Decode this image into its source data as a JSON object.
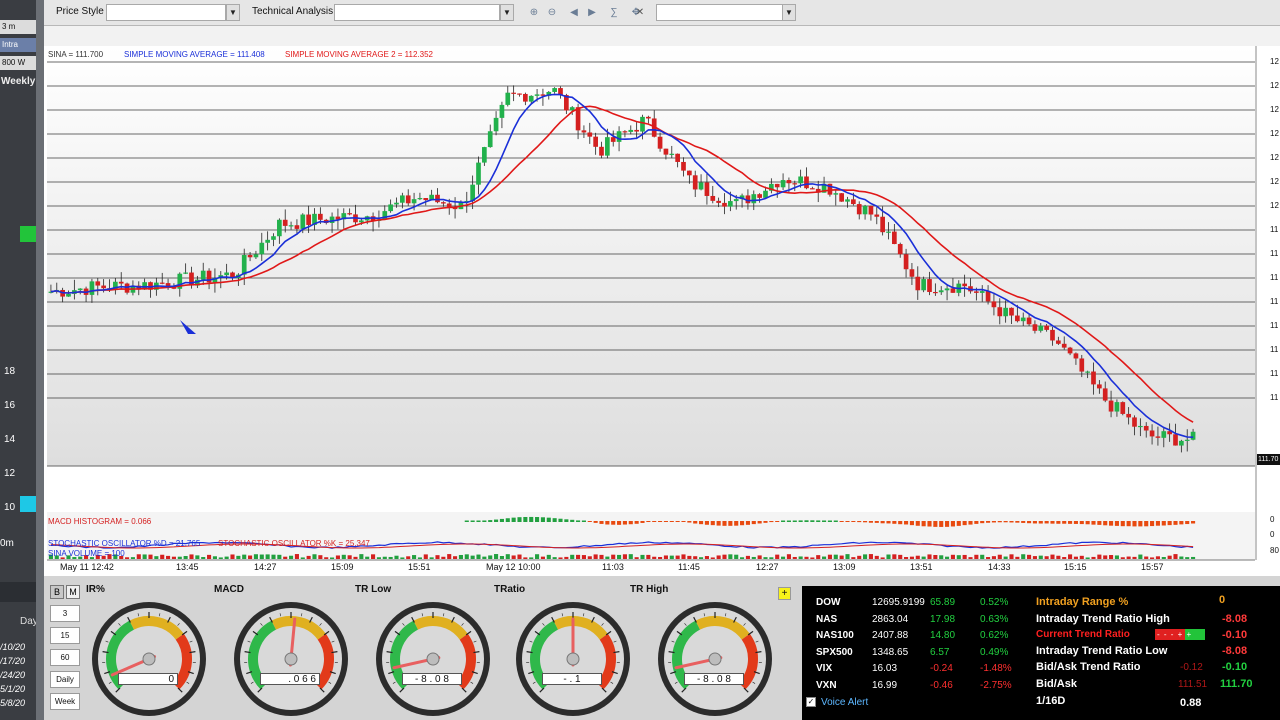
{
  "left_panel": {
    "tabs": [
      "3 m",
      "Intra",
      "800 W"
    ],
    "weekly_label": "Weekly",
    "price_ticks": [
      "18",
      "16",
      "14",
      "12",
      "10"
    ],
    "time_label": "0m",
    "day_label": "Day",
    "dates": [
      "/10/20",
      "/17/20",
      "/24/20",
      "5/1/20",
      "5/8/20"
    ]
  },
  "toolbar": {
    "price_style_label": "Price Style",
    "technical_analysis_label": "Technical Analysis"
  },
  "chart": {
    "legend": {
      "sina": "SINA = 111.700",
      "sma1": "SIMPLE MOVING AVERAGE = 111.408",
      "sma2": "SIMPLE MOVING AVERAGE 2 = 112.352"
    },
    "current_price_tag": "111.70",
    "indicators": {
      "macd": "MACD HISTOGRAM = 0.066",
      "stoch_k": "STOCHASTIC OSCILLATOR %D = 21.765",
      "stoch_d": "STOCHASTIC OSCILLATOR %K = 25.347",
      "volume": "SINA VOLUME = 100"
    },
    "right_ticks": [
      "12",
      "12",
      "12",
      "12",
      "12",
      "12",
      "12",
      "11",
      "11",
      "11",
      "11",
      "11",
      "11",
      "11",
      "11"
    ],
    "indicator_ticks": [
      "0",
      "0",
      "80"
    ],
    "x_labels": [
      "May 11 12:42",
      "13:45",
      "14:27",
      "15:09",
      "15:51",
      "May 12 10:00",
      "11:03",
      "11:45",
      "12:27",
      "13:09",
      "13:51",
      "14:33",
      "15:15",
      "15:57"
    ],
    "colors": {
      "up": "#22b14c",
      "down": "#d42020",
      "sma1": "#1a2fd8",
      "sma2": "#e01818"
    }
  },
  "chart_data": {
    "type": "candlestick",
    "x_labels": [
      "May 11 12:42",
      "13:45",
      "14:27",
      "15:09",
      "15:51",
      "May 12 10:00",
      "11:03",
      "11:45",
      "12:27",
      "13:09",
      "13:51",
      "14:33",
      "15:15",
      "15:57"
    ],
    "series": [
      {
        "name": "SINA",
        "last": 111.7
      },
      {
        "name": "SIMPLE MOVING AVERAGE",
        "last": 111.408
      },
      {
        "name": "SIMPLE MOVING AVERAGE 2",
        "last": 112.352
      }
    ],
    "close_path": [
      107.05,
      107.3,
      107.4,
      107.7,
      108.0,
      110.8,
      111.1,
      111.3,
      112.3,
      111.8,
      117.9,
      118.3,
      114.9,
      116.6,
      113.1,
      111.9,
      113.4,
      112.9,
      111.3,
      107.4,
      107.4,
      105.6,
      104.3,
      101.2,
      99.0,
      98.8
    ]
  },
  "bottom": {
    "period_buttons": [
      "B",
      "M",
      "3",
      "15",
      "60",
      "Daily",
      "Week"
    ],
    "gauges": [
      {
        "title": "IR%",
        "value": "0",
        "needle": 0.08
      },
      {
        "title": "MACD",
        "value": ". 0 6 6",
        "needle": 0.52
      },
      {
        "title": "TR Low",
        "value": "- 8 . 0 8",
        "needle": 0.12
      },
      {
        "title": "TRatio",
        "value": "- .  1",
        "needle": 0.5
      },
      {
        "title": "TR High",
        "value": "- 8 . 0 8",
        "needle": 0.12
      }
    ],
    "yellow_button": "+"
  },
  "market": [
    {
      "sym": "DOW",
      "last": "12695.9199",
      "chg": "65.89",
      "pct": "0.52%",
      "up": true
    },
    {
      "sym": "NAS",
      "last": "2863.04",
      "chg": "17.98",
      "pct": "0.63%",
      "up": true
    },
    {
      "sym": "NAS100",
      "last": "2407.88",
      "chg": "14.80",
      "pct": "0.62%",
      "up": true
    },
    {
      "sym": "SPX500",
      "last": "1348.65",
      "chg": "6.57",
      "pct": "0.49%",
      "up": true
    },
    {
      "sym": "VIX",
      "last": "16.03",
      "chg": "-0.24",
      "pct": "-1.48%",
      "up": false
    },
    {
      "sym": "VXN",
      "last": "16.99",
      "chg": "-0.46",
      "pct": "-2.75%",
      "up": false
    }
  ],
  "voice_alert": "Voice Alert",
  "trend": {
    "range_label": "Intraday Range %",
    "range_value": "0",
    "high_label": "Intraday Trend Ratio High",
    "high_value": "-8.08",
    "current_label": "Current Trend Ratio",
    "current_value": "-0.10",
    "current_bar": "- - - + +",
    "low_label": "Intraday Trend Ratio Low",
    "low_value": "-8.08",
    "bidask_ratio_label": "Bid/Ask Trend Ratio",
    "bidask_ratio_bid": "-0.12",
    "bidask_ratio_ask": "-0.10",
    "bidask_label": "Bid/Ask",
    "bid": "111.51",
    "ask": "111.70",
    "tick_label": "1/16D",
    "tick_value": "0.88"
  }
}
